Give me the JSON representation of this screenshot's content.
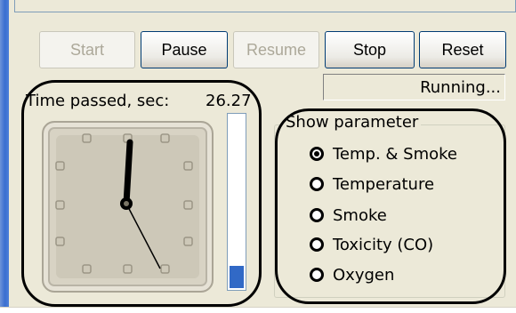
{
  "toolbar": {
    "start_label": "Start",
    "pause_label": "Pause",
    "resume_label": "Resume",
    "stop_label": "Stop",
    "reset_label": "Reset"
  },
  "status": {
    "text": "Running..."
  },
  "timer": {
    "label": "Time passed, sec:",
    "value": "26.27"
  },
  "progress": {
    "fraction": 0.13,
    "color": "#3169c6"
  },
  "show_parameter": {
    "title": "Show parameter",
    "options": [
      {
        "label": "Temp. & Smoke",
        "selected": true
      },
      {
        "label": "Temperature",
        "selected": false
      },
      {
        "label": "Smoke",
        "selected": false
      },
      {
        "label": "Toxicity (CO)",
        "selected": false
      },
      {
        "label": "Oxygen",
        "selected": false
      }
    ]
  },
  "colors": {
    "window_bg": "#ece9d8",
    "border_blue": "#7f9db9",
    "accent_blue": "#3169c6"
  }
}
